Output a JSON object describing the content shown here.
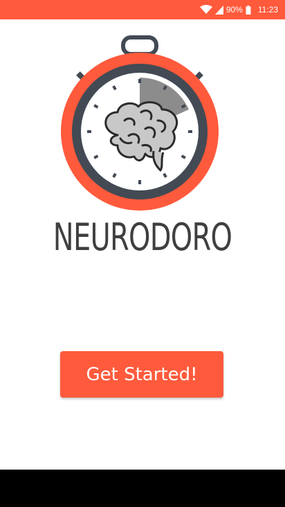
{
  "status_bar": {
    "battery_percent": "90%",
    "time": "11:23",
    "icons": [
      "wifi-icon",
      "signal-icon",
      "battery-icon"
    ]
  },
  "app": {
    "title": "NEURODORO",
    "cta_label": "Get Started!"
  },
  "colors": {
    "accent": "#ff5a3c",
    "dark": "#434a54",
    "title_text": "#3f3f3f",
    "brain_fill": "#c8c8c8",
    "sector_fill": "#8c8c8c"
  }
}
